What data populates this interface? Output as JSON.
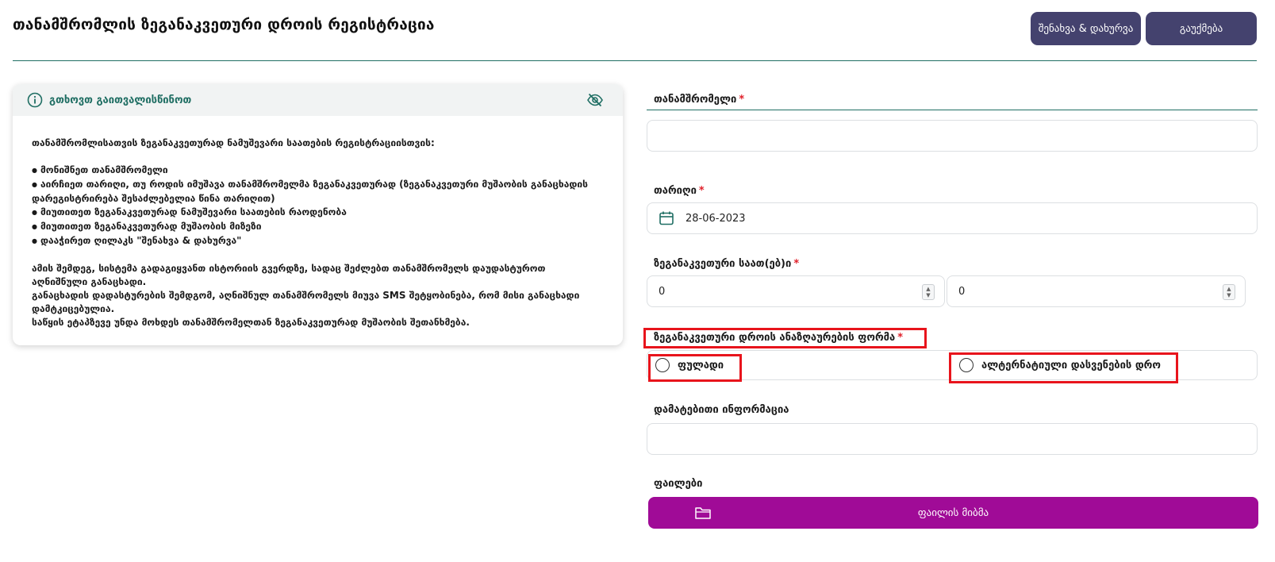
{
  "header": {
    "title": "თანამშრომლის ზეგანაკვეთური დროის რეგისტრაცია",
    "save_close_label": "შენახვა & დახურვა",
    "cancel_label": "გაუქმება"
  },
  "info": {
    "title": "გთხოვთ გაითვალისწინოთ",
    "intro": "თანამშრომლისათვის ზეგანაკვეთურად ნამუშევარი საათების რეგისტრაციისთვის:",
    "steps": [
      "მონიშნეთ თანამშრომელი",
      "აირჩიეთ თარიღი, თუ როდის იმუშავა თანამშრომელმა ზეგანაკვეთურად (ზეგანაკვეთური მუშაობის განაცხადის დარეგისტრირება შესაძლებელია წინა თარიღით)",
      "მიუთითეთ ზეგანაკვეთურად ნამუშევარი საათების რაოდენობა",
      "მიუთითეთ ზეგანაკვეთურად მუშაობის მიზეზი",
      "დააჭირეთ ღილაკს \"შენახვა & დახურვა\""
    ],
    "para1": "ამის შემდეგ, სისტემა გადაგიყვანთ ისტორიის გვერდზე, სადაც შეძლებთ თანამშრომელს დაუდასტუროთ აღნიშნული განაცხადი.",
    "para2": "განაცხადის დადასტურების შემდგომ, აღნიშნულ თანამშრომელს მიუვა SMS შეტყობინება, რომ მისი განაცხადი დამტკიცებულია.",
    "para3": "საწყის ეტაპზევე უნდა მოხდეს თანამშრომელთან ზეგანაკვეთურად მუშაობის შეთანხმება."
  },
  "form": {
    "employee_label": "თანამშრომელი",
    "employee_value": "",
    "date_label": "თარიღი",
    "date_value": "28-06-2023",
    "hours_label": "ზეგანაკვეთური საათ(ებ)ი",
    "hours_value": "0",
    "minutes_value": "0",
    "compensation_label": "ზეგანაკვეთური დროის ანაზღაურების ფორმა",
    "option_money": "ფულადი",
    "option_alt": "ალტერნატიული დასვენების დრო",
    "extra_label": "დამატებითი ინფორმაცია",
    "extra_value": "",
    "files_label": "ფაილები",
    "upload_label": "ფაილის მიბმა",
    "required_mark": "*"
  },
  "colors": {
    "primary_button": "#44426e",
    "accent": "#1f6e63",
    "upload_button": "#a00b97",
    "required": "#e0202a",
    "highlight": "#e8141c"
  },
  "icons": [
    "info-icon",
    "eye-off-icon",
    "calendar-icon",
    "folder-icon"
  ]
}
